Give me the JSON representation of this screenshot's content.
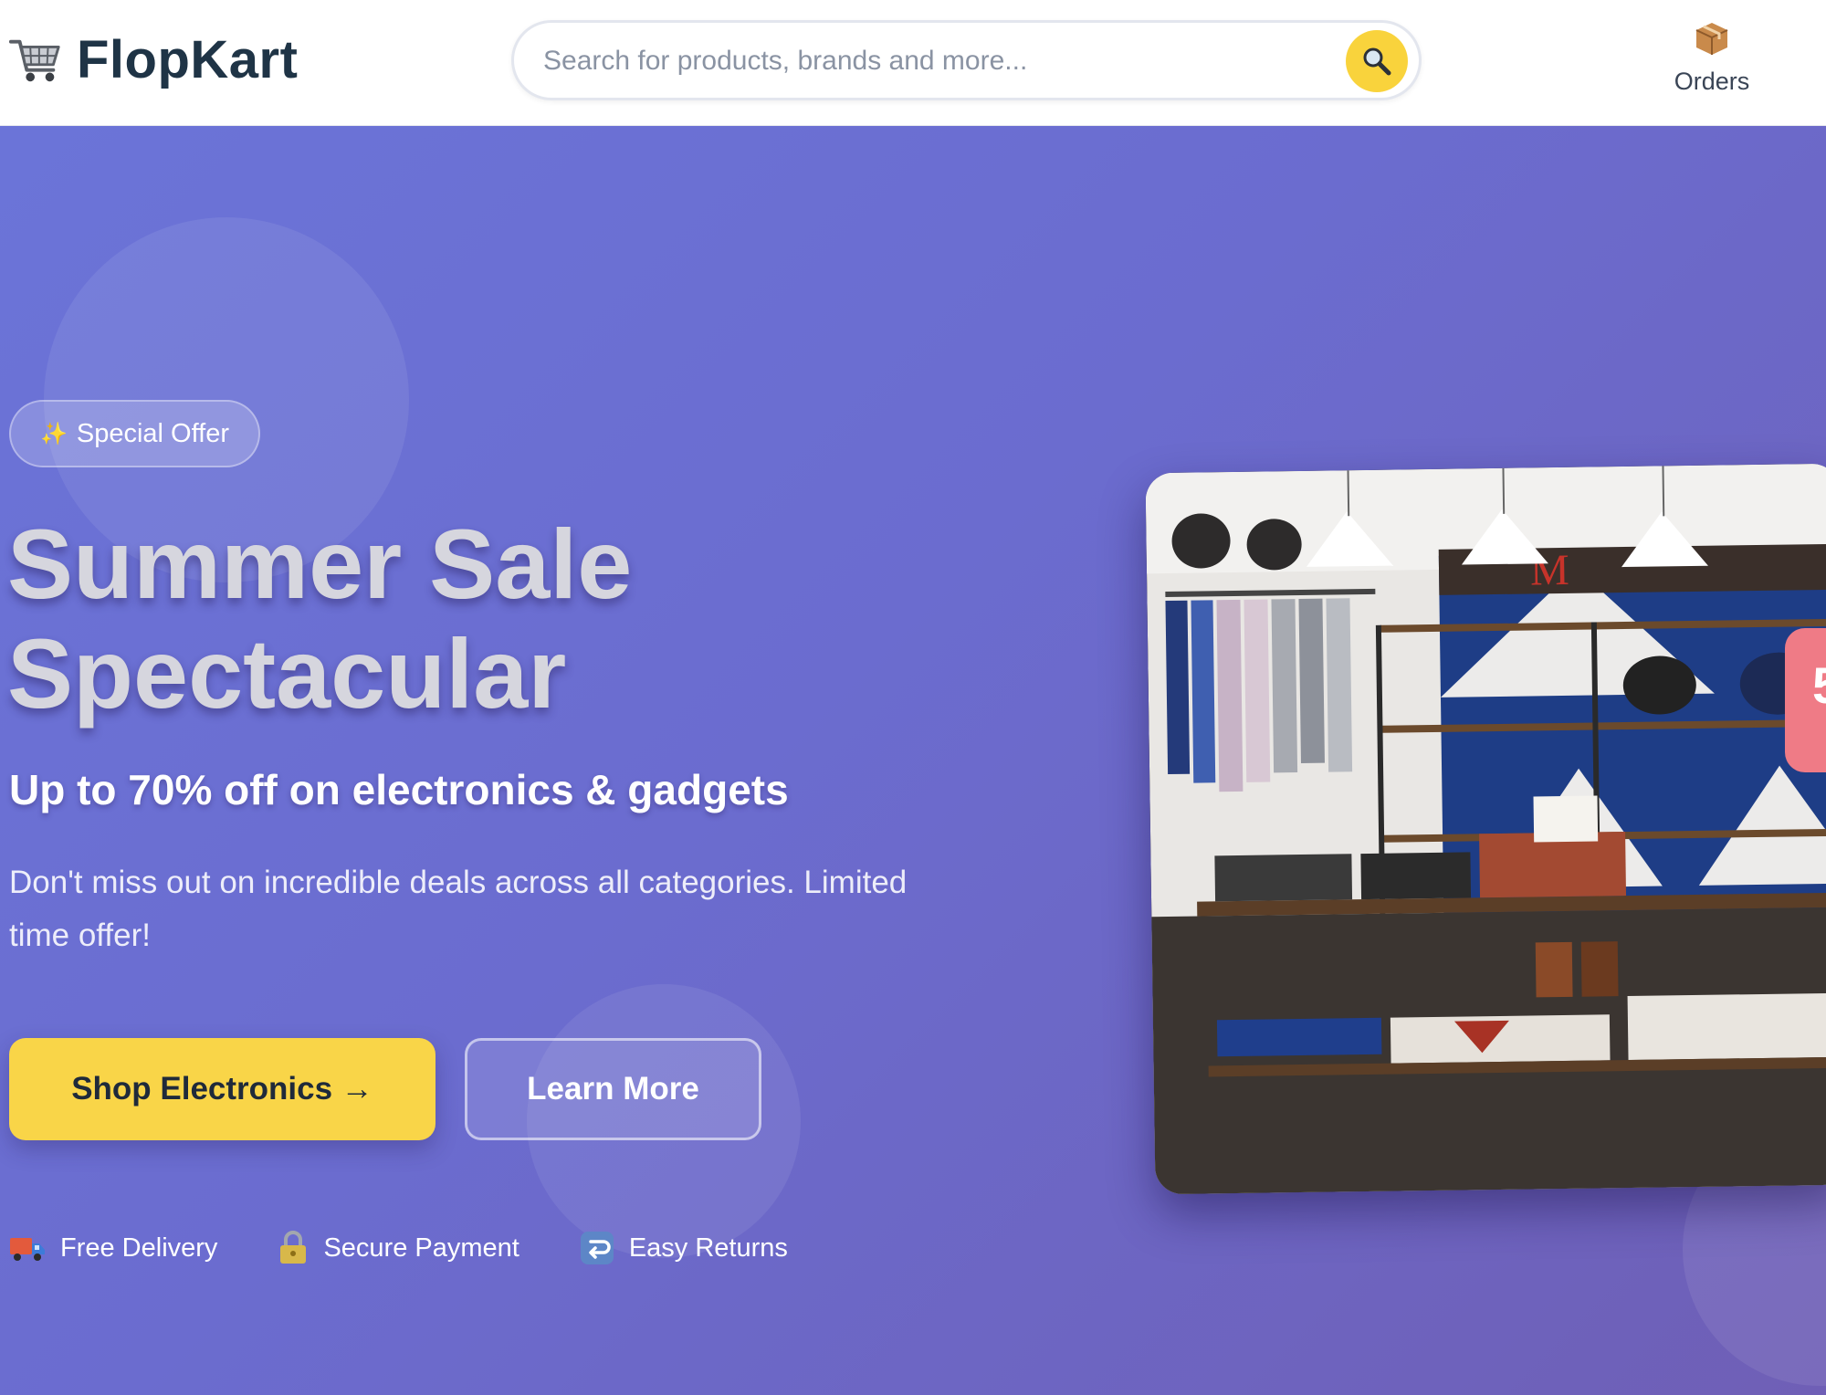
{
  "header": {
    "brand": "FlopKart",
    "search": {
      "placeholder": "Search for products, brands and more...",
      "value": ""
    },
    "orders_label": "Orders"
  },
  "hero": {
    "badge": "Special Offer",
    "title_line1": "Summer Sale",
    "title_line2": "Spectacular",
    "subtitle": "Up to 70% off on electronics & gadgets",
    "description": "Don't miss out on incredible deals across all categories. Limited time offer!",
    "primary_button": "Shop Electronics →",
    "secondary_button": "Learn More",
    "features": [
      {
        "icon": "delivery-truck-icon",
        "label": "Free Delivery"
      },
      {
        "icon": "lock-icon",
        "label": "Secure Payment"
      },
      {
        "icon": "return-arrow-icon",
        "label": "Easy Returns"
      }
    ],
    "discount_tag_visible": "5"
  },
  "colors": {
    "brand_text": "#1f3446",
    "accent_yellow": "#f9d548",
    "hero_gradient_start": "#6b74d8",
    "hero_gradient_end": "#6f5fb6",
    "tag_pink": "#ef7b86"
  }
}
